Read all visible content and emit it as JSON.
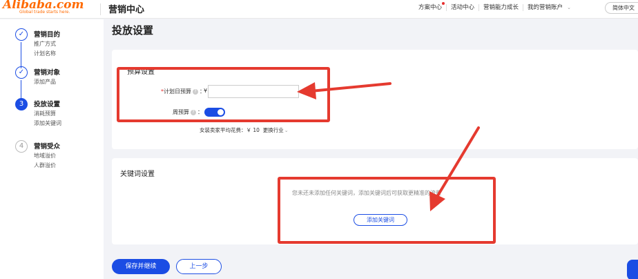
{
  "header": {
    "logo_text": "Alibaba.com",
    "logo_tagline": "Global trade starts here.",
    "title": "营销中心",
    "nav": [
      "方案中心",
      "活动中心",
      "营销能力成长",
      "我的营销账户"
    ],
    "language": "简体中文"
  },
  "steps": [
    {
      "number": "1",
      "title": "营销目的",
      "subs": [
        "推广方式",
        "计划名称"
      ],
      "state": "done"
    },
    {
      "number": "2",
      "title": "营销对象",
      "subs": [
        "添加产品"
      ],
      "state": "done"
    },
    {
      "number": "3",
      "title": "投放设置",
      "subs": [
        "消耗预算",
        "添加关键词"
      ],
      "state": "active"
    },
    {
      "number": "4",
      "title": "营销受众",
      "subs": [
        "地域溢价",
        "人群溢价"
      ],
      "state": "todo"
    }
  ],
  "page_title": "投放设置",
  "budget": {
    "heading": "预算设置",
    "required_mark": "*",
    "daily_label": "计划日预算",
    "colon": "：",
    "currency": "¥",
    "daily_value": "",
    "weekly_label": "周预算",
    "weekly_enabled": true,
    "avg_text": "女装卖家平均花费：￥ 10",
    "change_industry": "更换行业"
  },
  "keywords": {
    "heading": "关键词设置",
    "empty_text": "您未还未添加任何关键词，添加关键词后可获取更精准的流量",
    "add_button": "添加关键词"
  },
  "footer": {
    "save_continue": "保存并继续",
    "previous": "上一步"
  },
  "colors": {
    "primary": "#1b4de4",
    "annotation": "#e53a2f",
    "brand": "#ff6a00"
  }
}
